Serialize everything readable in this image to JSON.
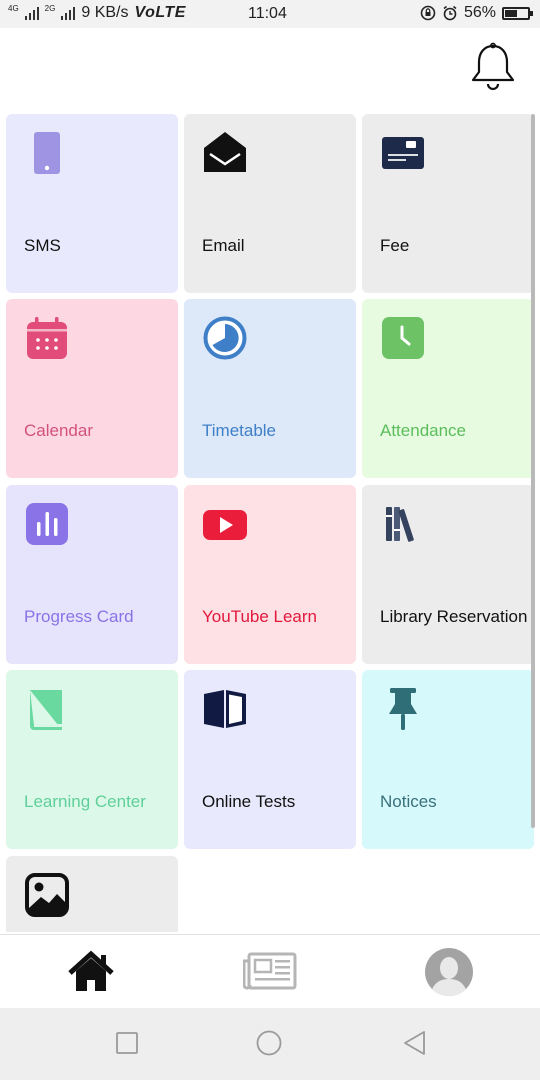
{
  "status_bar": {
    "net_tag_1": "4G",
    "net_tag_2": "2G",
    "speed": "9 KB/s",
    "network_mode": "VoLTE",
    "time": "11:04",
    "battery": "56%",
    "battery_level": 0.56
  },
  "header": {
    "bell_icon": "bell-icon"
  },
  "tiles": [
    {
      "label": "SMS",
      "icon": "phone-icon",
      "bg": "#e9e9fd",
      "color": "#111111",
      "icon_color": "#9f93e4"
    },
    {
      "label": "Email",
      "icon": "envelope-open-icon",
      "bg": "#ececec",
      "color": "#111111",
      "icon_color": "#111111"
    },
    {
      "label": "Fee",
      "icon": "credit-card-icon",
      "bg": "#ececec",
      "color": "#111111",
      "icon_color": "#1e2a4a"
    },
    {
      "label": "Calendar",
      "icon": "calendar-icon",
      "bg": "#fdd8e3",
      "color": "#d2527f",
      "icon_color": "#e24c7b"
    },
    {
      "label": "Timetable",
      "icon": "clock-pie-icon",
      "bg": "#dde9f9",
      "color": "#3f7fc8",
      "icon_color": "#3f7fc8"
    },
    {
      "label": "Attendance",
      "icon": "clock-square-icon",
      "bg": "#e6fbe0",
      "color": "#5cbd5c",
      "icon_color": "#6cc265"
    },
    {
      "label": "Progress Card",
      "icon": "bar-chart-icon",
      "bg": "#e6e3fc",
      "color": "#8a73e6",
      "icon_color": "#8a73e6"
    },
    {
      "label": "YouTube Learn",
      "icon": "youtube-icon",
      "bg": "#fde1e5",
      "color": "#e2183c",
      "icon_color": "#ea1d3a"
    },
    {
      "label": "Library Reservation",
      "icon": "books-icon",
      "bg": "#ececec",
      "color": "#111111",
      "icon_color": "#35425e"
    },
    {
      "label": "Learning Center",
      "icon": "book-icon",
      "bg": "#dcf8e8",
      "color": "#5fd09a",
      "icon_color": "#6ad9a0"
    },
    {
      "label": "Online Tests",
      "icon": "book-open-icon",
      "bg": "#e9e9fd",
      "color": "#111111",
      "icon_color": "#111a42"
    },
    {
      "label": "Notices",
      "icon": "pushpin-icon",
      "bg": "#d6f9fb",
      "color": "#39707b",
      "icon_color": "#2f6e76"
    },
    {
      "label": "",
      "icon": "image-icon",
      "bg": "#ececec",
      "color": "#111111",
      "icon_color": "#111111"
    }
  ],
  "bottom_nav": [
    {
      "icon": "home-icon",
      "active": true
    },
    {
      "icon": "newspaper-icon",
      "active": false
    },
    {
      "icon": "avatar-icon",
      "active": false
    }
  ],
  "system_nav": [
    "recent-apps-button",
    "home-button",
    "back-button"
  ]
}
